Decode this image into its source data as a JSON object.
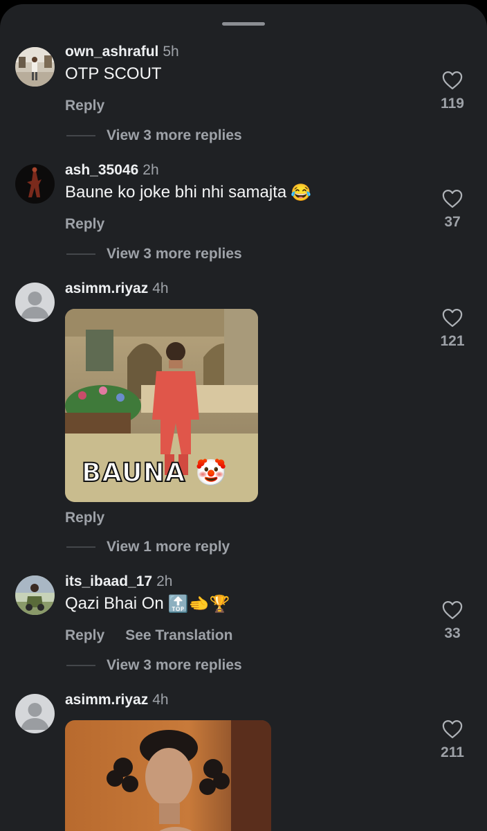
{
  "sheet": {
    "handle": "drag-handle"
  },
  "comments": [
    {
      "username": "own_ashraful",
      "time": "5h",
      "text": "OTP SCOUT",
      "reply_label": "Reply",
      "view_replies": "View 3 more replies",
      "likes": "119"
    },
    {
      "username": "ash_35046",
      "time": "2h",
      "text": "Baune ko joke bhi nhi samajta",
      "emoji": "😂",
      "reply_label": "Reply",
      "view_replies": "View 3 more replies",
      "likes": "37"
    },
    {
      "username": "asimm.riyaz",
      "time": "4h",
      "gif_caption": "BAUNA",
      "gif_emoji": "🤡",
      "reply_label": "Reply",
      "view_replies": "View 1 more reply",
      "likes": "121"
    },
    {
      "username": "its_ibaad_17",
      "time": "2h",
      "text": "Qazi Bhai On",
      "emoji": "🔝🫲🏆",
      "reply_label": "Reply",
      "translate_label": "See Translation",
      "view_replies": "View 3 more replies",
      "likes": "33"
    },
    {
      "username": "asimm.riyaz",
      "time": "4h",
      "likes": "211"
    }
  ],
  "icons": {
    "like": "heart-icon",
    "default_avatar": "person-icon"
  },
  "colors": {
    "background": "#1f2124",
    "text": "#f4f5f6",
    "muted": "#9ea2a8"
  }
}
